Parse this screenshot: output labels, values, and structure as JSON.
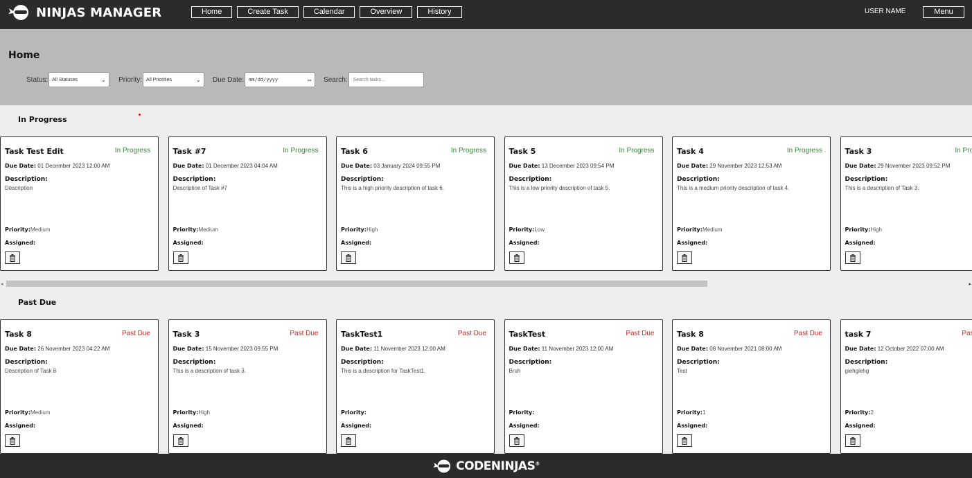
{
  "app": {
    "title": "NINJAS MANAGER",
    "logo_icon": "ninja-logo-icon"
  },
  "nav": {
    "items": [
      "Home",
      "Create Task",
      "Calendar",
      "Overview",
      "History"
    ]
  },
  "user": {
    "name": "USER NAME",
    "menu_label": "Menu"
  },
  "page": {
    "title": "Home"
  },
  "filters": {
    "status_label": "Status:",
    "status_value": "All Statuses",
    "priority_label": "Priority:",
    "priority_value": "All Priorities",
    "due_label": "Due Date:",
    "due_placeholder": "mm/dd/yyyy",
    "search_label": "Search:",
    "search_placeholder": "Search tasks..."
  },
  "labels": {
    "due": "Due Date:",
    "description": "Description:",
    "priority": "Priority:",
    "assigned": "Assigned:"
  },
  "colors": {
    "in_progress": "#2f8a2f",
    "past_due": "#d42020",
    "topbar": "#2b2b2b",
    "filterbar": "#b9b9b9"
  },
  "sections": [
    {
      "title": "In Progress",
      "status_class": "st-progress",
      "cards": [
        {
          "title": "Task Test Edit",
          "status": "In Progress",
          "due": "01 December 2023 12:00 AM",
          "description": "Description",
          "priority": "Medium",
          "assigned": ""
        },
        {
          "title": "Task #7",
          "status": "In Progress",
          "due": "01 December 2023 04:04 AM",
          "description": "Description of Task #7",
          "priority": "Medium",
          "assigned": ""
        },
        {
          "title": "Task 6",
          "status": "In Progress",
          "due": "03 January 2024 09:55 PM",
          "description": "This is a high priority description of task 6.",
          "priority": "High",
          "assigned": ""
        },
        {
          "title": "Task 5",
          "status": "In Progress",
          "due": "13 December 2023 09:54 PM",
          "description": "This is a low priority description of task 5.",
          "priority": "Low",
          "assigned": ""
        },
        {
          "title": "Task 4",
          "status": "In Progress",
          "due": "29 November 2023 12:53 AM",
          "description": "This is a medium priority description of task 4.",
          "priority": "Medium",
          "assigned": ""
        },
        {
          "title": "Task 3",
          "status": "In Progress",
          "due": "29 November 2023 09:52 PM",
          "description": "This is a description of Task 3.",
          "priority": "High",
          "assigned": ""
        }
      ]
    },
    {
      "title": "Past Due",
      "status_class": "st-pastdue",
      "cards": [
        {
          "title": "Task 8",
          "status": "Past Due",
          "due": "26 November 2023 04:22 AM",
          "description": "Description of Task 8",
          "priority": "Medium",
          "assigned": ""
        },
        {
          "title": "Task 3",
          "status": "Past Due",
          "due": "15 November 2023 09:55 PM",
          "description": "This is a description of task 3.",
          "priority": "High",
          "assigned": ""
        },
        {
          "title": "TaskTest1",
          "status": "Past Due",
          "due": "11 November 2023 12:00 AM",
          "description": "This is a description for TaskTest1.",
          "priority": "",
          "assigned": ""
        },
        {
          "title": "TaskTest",
          "status": "Past Due",
          "due": "11 November 2023 12:00 AM",
          "description": "Bruh",
          "priority": "",
          "assigned": ""
        },
        {
          "title": "Task 8",
          "status": "Past Due",
          "due": "08 November 2021 08:00 AM",
          "description": "Test",
          "priority": "1",
          "assigned": ""
        },
        {
          "title": "task 7",
          "status": "Past Due",
          "due": "12 October 2022 07:00 AM",
          "description": "giehgiehg",
          "priority": "2",
          "assigned": ""
        }
      ]
    }
  ],
  "footer": {
    "brand": "CODENINJAS",
    "mark": "®"
  }
}
